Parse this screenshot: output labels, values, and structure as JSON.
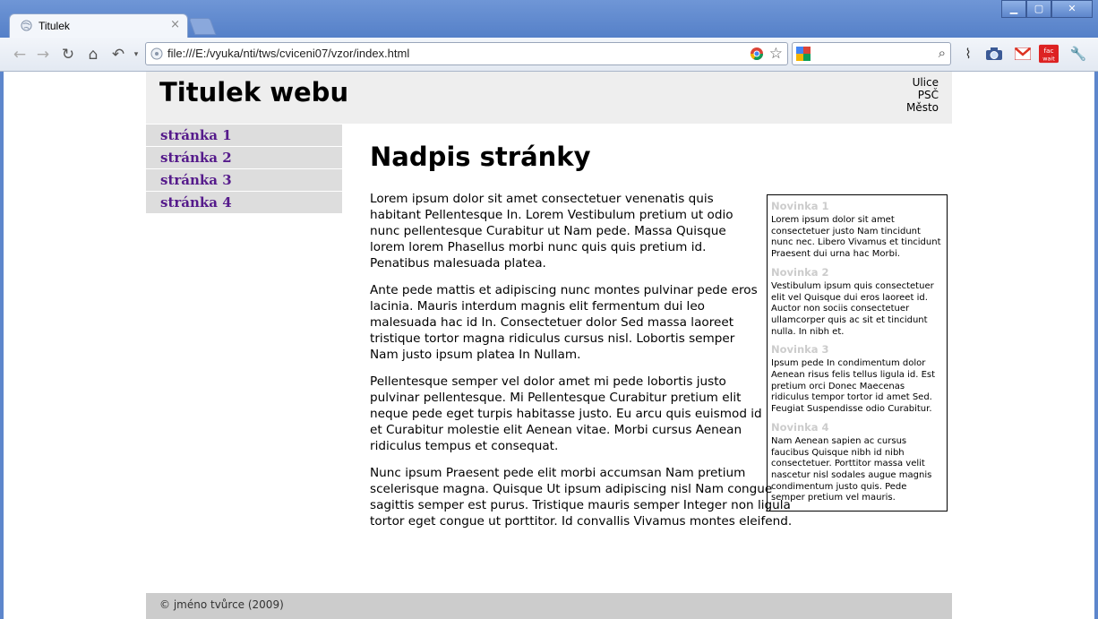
{
  "browser": {
    "tab_title": "Titulek",
    "tab_close": "×",
    "url": "file:///E:/vyuka/nti/tws/cviceni07/vzor/index.html",
    "search_value": ""
  },
  "site": {
    "title": "Titulek webu",
    "address": [
      "Ulice",
      "PSČ",
      "Město"
    ],
    "menu": [
      "stránka 1",
      "stránka 2",
      "stránka 3",
      "stránka 4"
    ],
    "heading": "Nadpis stránky",
    "paragraphs": [
      "Lorem ipsum dolor sit amet consectetuer venenatis quis habitant Pellentesque In. Lorem Vestibulum pretium ut odio nunc pellentesque Curabitur ut Nam pede. Massa Quisque lorem lorem Phasellus morbi nunc quis quis pretium id. Penatibus malesuada platea.",
      "Ante pede mattis et adipiscing nunc montes pulvinar pede eros lacinia. Mauris interdum magnis elit fermentum dui leo malesuada hac id In. Consectetuer dolor Sed massa laoreet tristique tortor magna ridiculus cursus nisl. Lobortis semper Nam justo ipsum platea In Nullam.",
      "Pellentesque semper vel dolor amet mi pede lobortis justo pulvinar pellentesque. Mi Pellentesque Curabitur pretium elit neque pede eget turpis habitasse justo. Eu arcu quis euismod id et Curabitur molestie elit Aenean vitae. Morbi cursus Aenean ridiculus tempus et consequat.",
      "Nunc ipsum Praesent pede elit morbi accumsan Nam pretium scelerisque magna. Quisque Ut ipsum adipiscing nisl Nam congue sagittis semper est purus. Tristique mauris semper Integer non ligula tortor eget congue ut porttitor. Id convallis Vivamus montes eleifend."
    ],
    "news": [
      {
        "title": "Novinka 1",
        "text": "Lorem ipsum dolor sit amet consectetuer justo Nam tincidunt nunc nec. Libero Vivamus et tincidunt Praesent dui urna hac Morbi."
      },
      {
        "title": "Novinka 2",
        "text": "Vestibulum ipsum quis consectetuer elit vel Quisque dui eros laoreet id. Auctor non sociis consectetuer ullamcorper quis ac sit et tincidunt nulla. In nibh et."
      },
      {
        "title": "Novinka 3",
        "text": "Ipsum pede In condimentum dolor Aenean risus felis tellus ligula id. Est pretium orci Donec Maecenas ridiculus tempor tortor id amet Sed. Feugiat Suspendisse odio Curabitur."
      },
      {
        "title": "Novinka 4",
        "text": "Nam Aenean sapien ac cursus faucibus Quisque nibh id nibh consectetuer. Porttitor massa velit nascetur nisl sodales augue magnis condimentum justo quis. Pede semper pretium vel mauris."
      }
    ],
    "footer": "© jméno tvůrce (2009)"
  },
  "colors": {
    "visited_link": "#551a8b",
    "menu_bg": "#dddddd",
    "header_bg": "#eeeeee",
    "footer_bg": "#cccccc",
    "news_title": "#cccccc"
  },
  "icons": [
    "back-icon",
    "forward-icon",
    "reload-icon",
    "home-icon",
    "history-icon",
    "page-icon",
    "chrome-icon",
    "bookmark-star-icon",
    "google-icon",
    "search-icon",
    "pulse-icon",
    "camera-icon",
    "gmail-icon",
    "fac-wait-icon",
    "wrench-icon"
  ]
}
